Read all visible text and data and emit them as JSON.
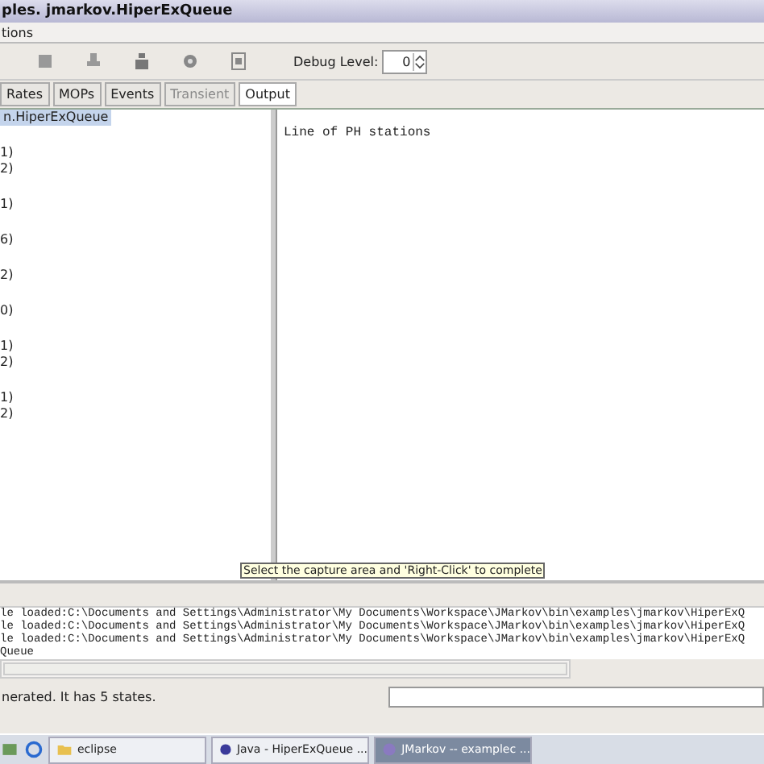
{
  "window": {
    "title": "ples. jmarkov.HiperExQueue"
  },
  "menu": [
    "tions"
  ],
  "toolbar": {
    "debug_label": "Debug Level:",
    "debug_value": "0"
  },
  "tabs": [
    {
      "label": "Rates",
      "selected": false,
      "disabled": false
    },
    {
      "label": "MOPs",
      "selected": false,
      "disabled": false
    },
    {
      "label": "Events",
      "selected": false,
      "disabled": false
    },
    {
      "label": "Transient",
      "selected": false,
      "disabled": true
    },
    {
      "label": "Output",
      "selected": true,
      "disabled": false
    }
  ],
  "tree": {
    "root": {
      "label": "n.HiperExQueue",
      "selected": true
    },
    "groups": [
      {
        "items": [
          "1)",
          "2)"
        ]
      },
      {
        "items": [
          "1)"
        ]
      },
      {
        "items": [
          "6)"
        ]
      },
      {
        "items": [
          "2)"
        ]
      },
      {
        "items": [
          "0)"
        ]
      },
      {
        "items": [
          "1)",
          "2)"
        ]
      },
      {
        "items": [
          "1)",
          "2)"
        ]
      }
    ]
  },
  "output": {
    "text": "Line of PH stations"
  },
  "tooltip": "Select the capture area and 'Right-Click' to complete",
  "console": [
    "le loaded:C:\\Documents and Settings\\Administrator\\My Documents\\Workspace\\JMarkov\\bin\\examples\\jmarkov\\HiperExQ",
    "le loaded:C:\\Documents and Settings\\Administrator\\My Documents\\Workspace\\JMarkov\\bin\\examples\\jmarkov\\HiperExQ",
    "le loaded:C:\\Documents and Settings\\Administrator\\My Documents\\Workspace\\JMarkov\\bin\\examples\\jmarkov\\HiperExQ",
    "Queue"
  ],
  "status": "nerated. It has 5 states.",
  "taskbar": [
    {
      "label": "eclipse",
      "kind": "folder",
      "selected": false
    },
    {
      "label": "Java - HiperExQueue ...",
      "kind": "java",
      "selected": false
    },
    {
      "label": "JMarkov -- examplec ...",
      "kind": "app",
      "selected": true
    }
  ]
}
